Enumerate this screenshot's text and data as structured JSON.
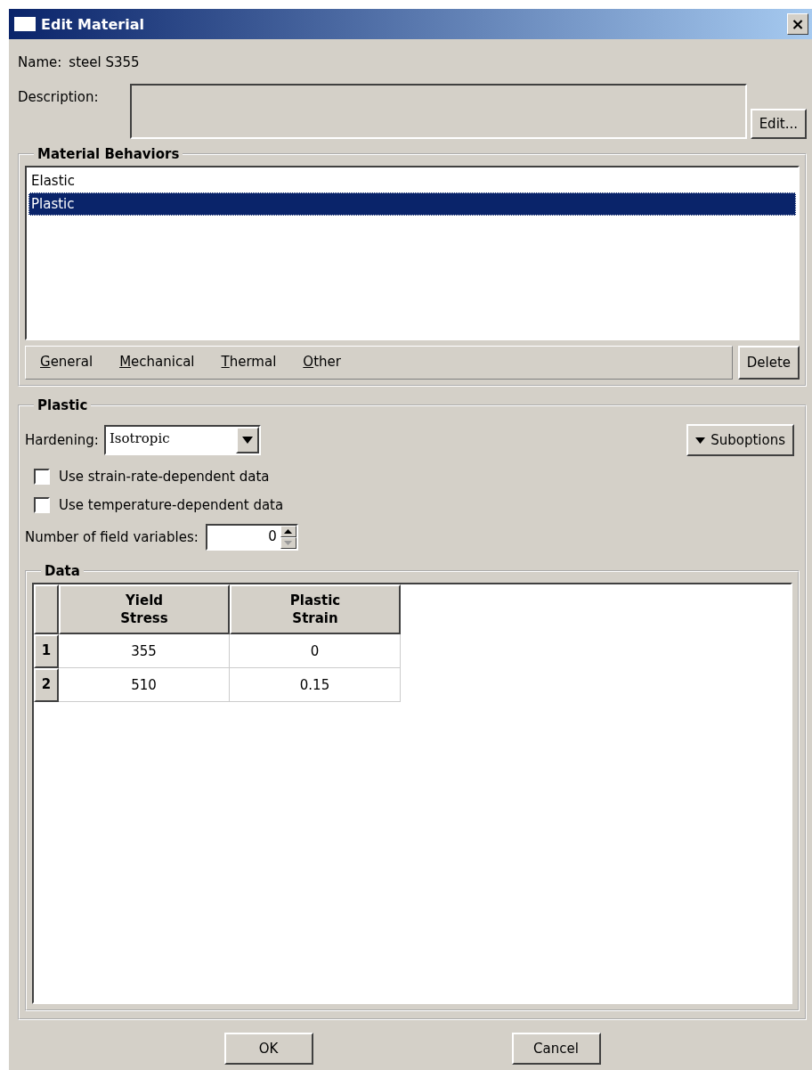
{
  "window": {
    "title": "Edit Material",
    "close": "×"
  },
  "name": {
    "label": "Name:",
    "value": "steel S355"
  },
  "description": {
    "label": "Description:",
    "button": "Edit..."
  },
  "behaviors": {
    "title": "Material Behaviors",
    "items": [
      {
        "label": "Elastic",
        "selected": false
      },
      {
        "label": "Plastic",
        "selected": true
      }
    ],
    "menus": [
      "General",
      "Mechanical",
      "Thermal",
      "Other"
    ],
    "delete": "Delete"
  },
  "plastic": {
    "title": "Plastic",
    "hardening_label": "Hardening:",
    "hardening": "Isotropic",
    "suboptions": "Suboptions",
    "options": [
      {
        "label": "Use strain-rate-dependent data",
        "checked": false
      },
      {
        "label": "Use temperature-dependent data",
        "checked": false
      }
    ],
    "field_vars_label": "Number of field variables:",
    "field_vars": "0"
  },
  "data": {
    "title": "Data",
    "columns": [
      "Yield\nStress",
      "Plastic\nStrain"
    ],
    "rows": [
      {
        "index": "1",
        "cells": [
          "355",
          "0"
        ]
      },
      {
        "index": "2",
        "cells": [
          "510",
          "0.15"
        ]
      }
    ]
  },
  "buttons": [
    "OK",
    "Cancel"
  ]
}
